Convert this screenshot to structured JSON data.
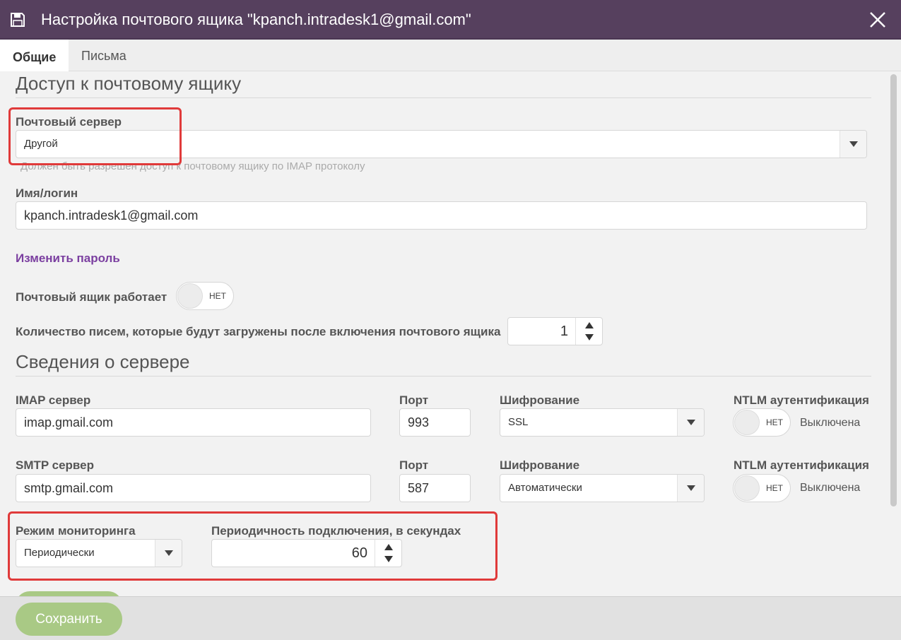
{
  "window": {
    "title": "Настройка почтового ящика \"kpanch.intradesk1@gmail.com\"",
    "save_icon": "floppy-disk-icon",
    "close_icon": "close-icon"
  },
  "tabs": [
    {
      "label": "Общие",
      "active": true
    },
    {
      "label": "Письма",
      "active": false
    }
  ],
  "mailbox_access": {
    "section_title": "Доступ к почтовому ящику",
    "mail_server_label": "Почтовый сервер",
    "mail_server_value": "Другой",
    "mail_server_hint": "Должен быть разрешен доступ к почтовому ящику по IMAP протоколу",
    "login_label": "Имя/логин",
    "login_value": "kpanch.intradesk1@gmail.com",
    "change_password_link": "Изменить пароль",
    "mailbox_works_label": "Почтовый ящик работает",
    "mailbox_works_toggle": "НЕТ",
    "emails_count_label": "Количество писем, которые будут загружены после включения почтового ящика",
    "emails_count_value": "1"
  },
  "server_info": {
    "section_title": "Сведения о сервере",
    "imap": {
      "server_label": "IMAP сервер",
      "server_value": "imap.gmail.com",
      "port_label": "Порт",
      "port_value": "993",
      "encryption_label": "Шифрование",
      "encryption_value": "SSL",
      "ntlm_label": "NTLM аутентификация",
      "ntlm_toggle": "НЕТ",
      "ntlm_status": "Выключена"
    },
    "smtp": {
      "server_label": "SMTP сервер",
      "server_value": "smtp.gmail.com",
      "port_label": "Порт",
      "port_value": "587",
      "encryption_label": "Шифрование",
      "encryption_value": "Автоматически",
      "ntlm_label": "NTLM аутентификация",
      "ntlm_toggle": "НЕТ",
      "ntlm_status": "Выключена"
    }
  },
  "monitoring": {
    "mode_label": "Режим мониторинга",
    "mode_value": "Периодически",
    "interval_label": "Периодичность подключения, в секундах",
    "interval_value": "60"
  },
  "footer": {
    "save_label": "Сохранить"
  },
  "colors": {
    "titlebar": "#56405e",
    "link": "#7b3fa0",
    "save_button": "#a9c985",
    "highlight": "#e03a3a"
  }
}
